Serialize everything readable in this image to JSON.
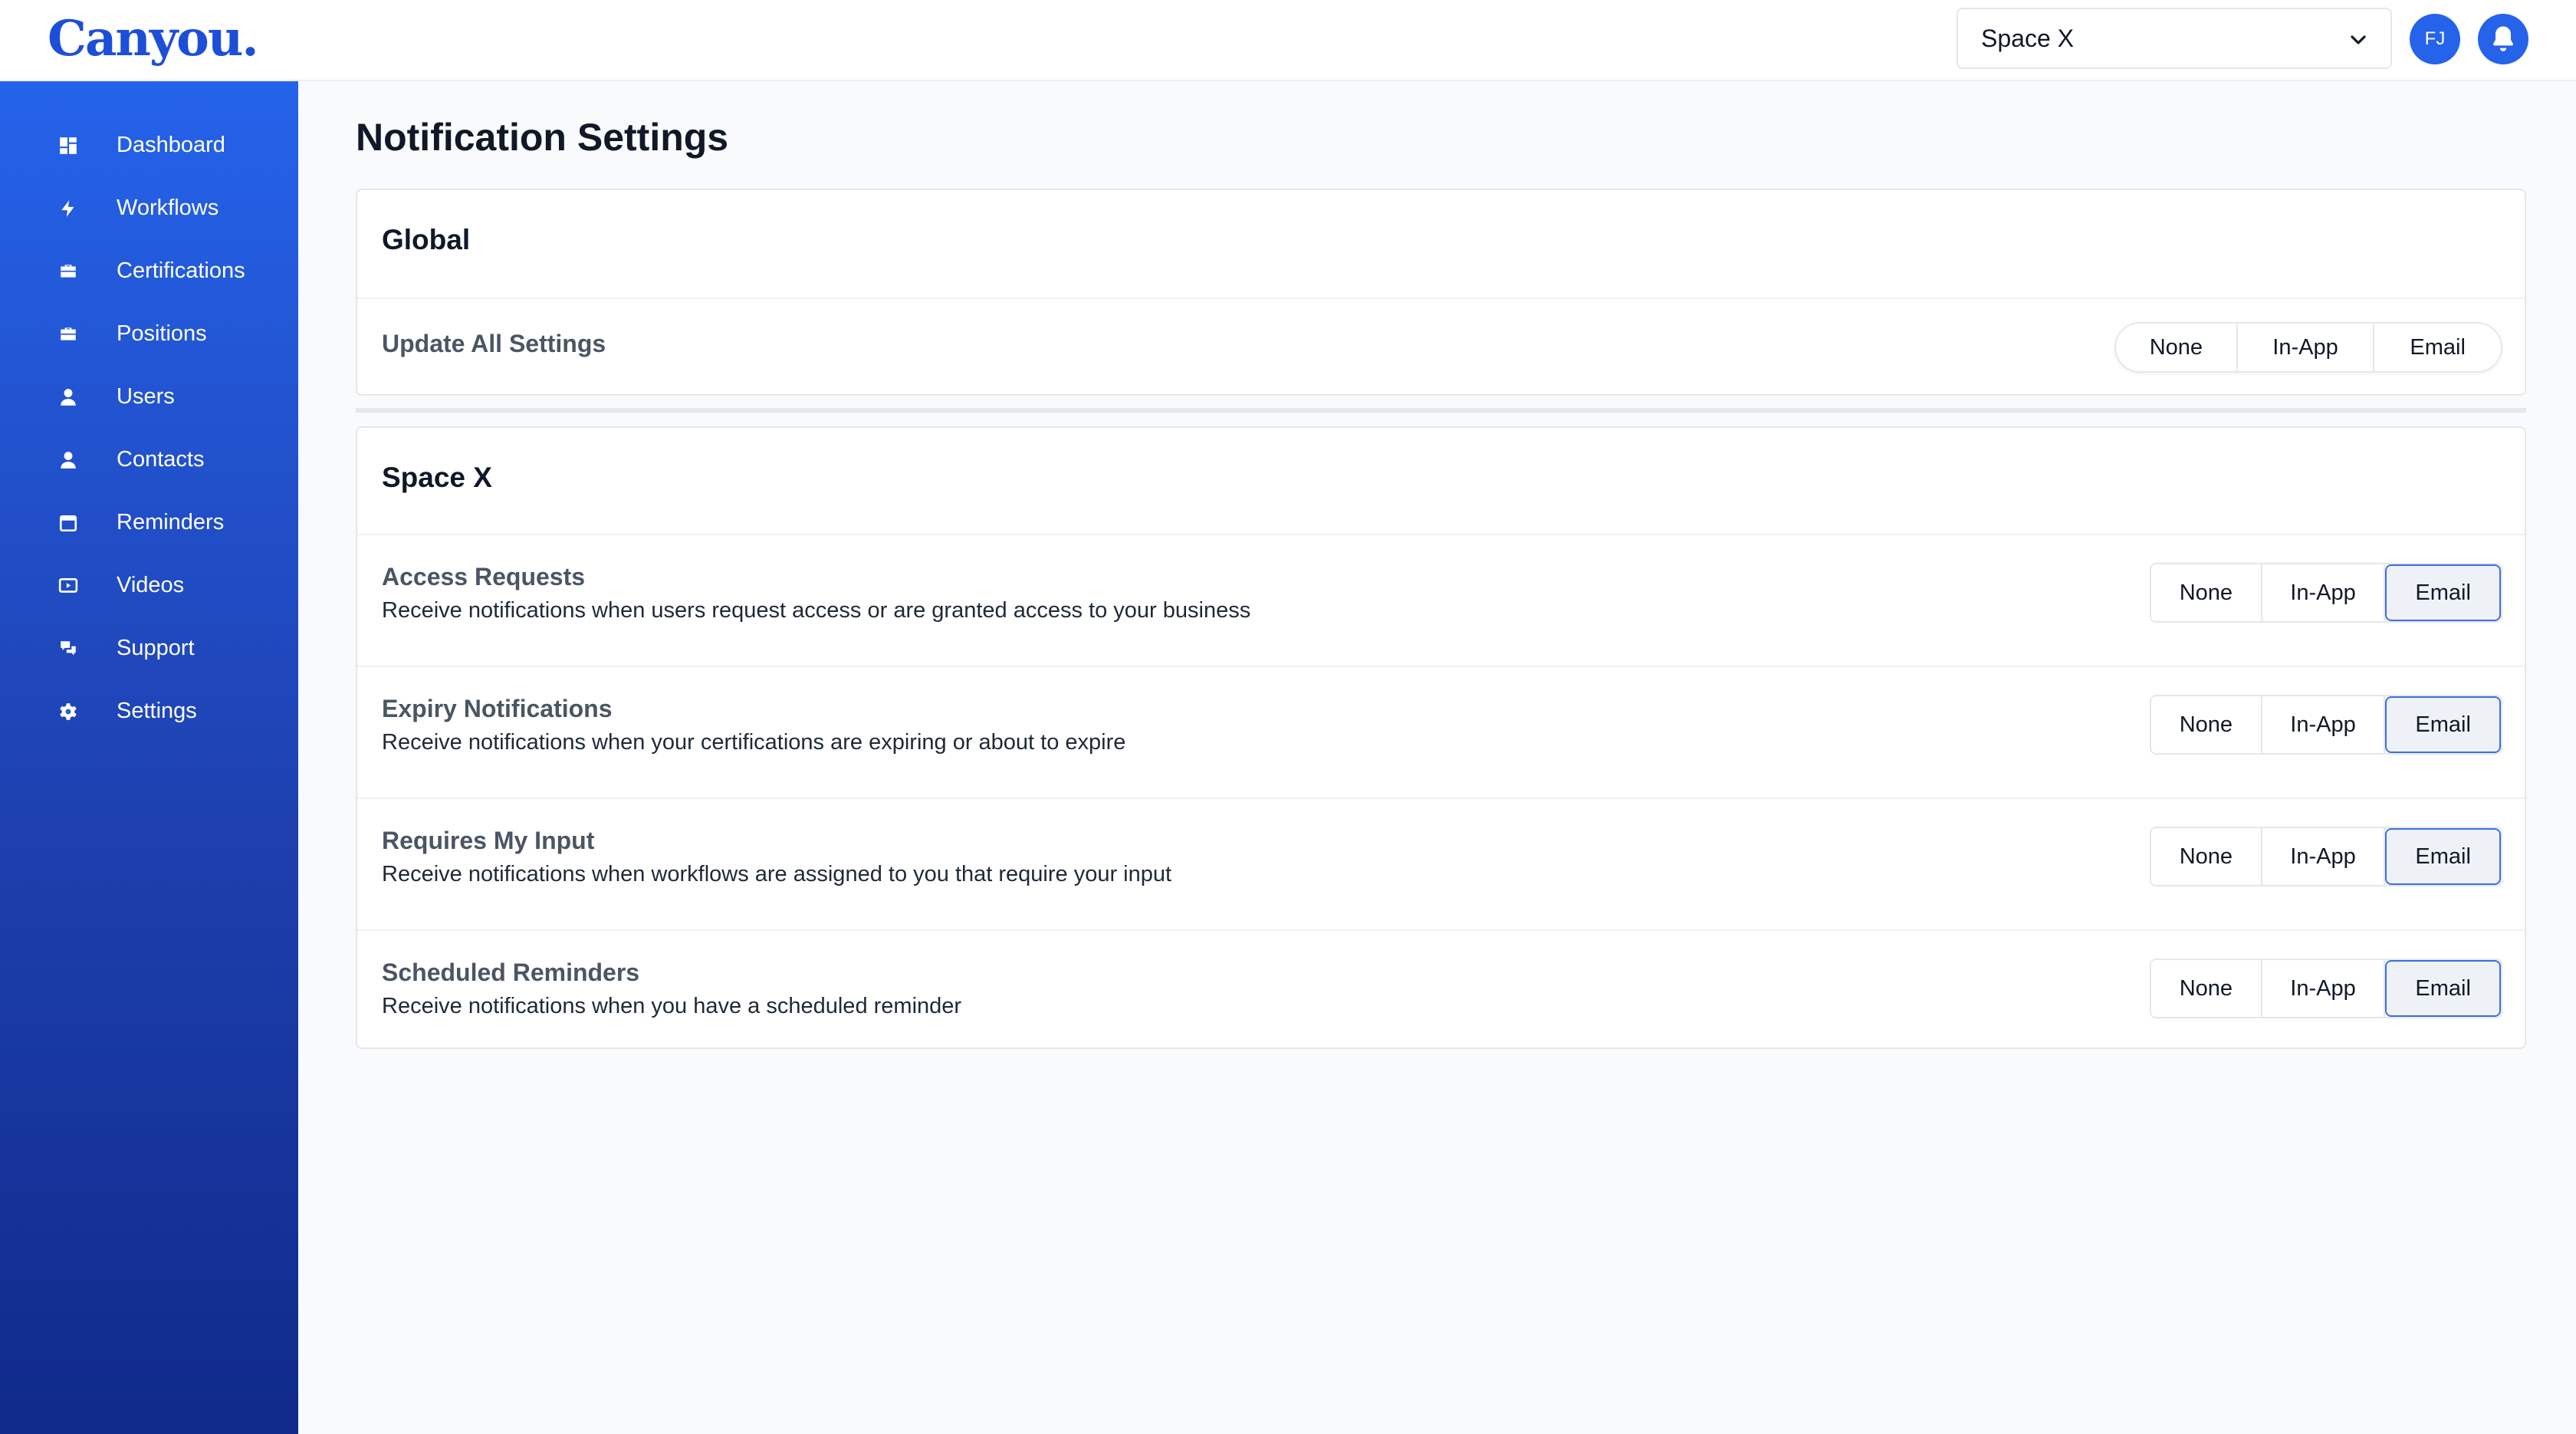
{
  "brand": {
    "logo_text": "Canyou."
  },
  "header": {
    "space_select": "Space X",
    "avatar_initials": "FJ"
  },
  "sidebar": {
    "items": [
      {
        "label": "Dashboard",
        "icon": "dashboard-icon"
      },
      {
        "label": "Workflows",
        "icon": "bolt-icon"
      },
      {
        "label": "Certifications",
        "icon": "briefcase-icon"
      },
      {
        "label": "Positions",
        "icon": "briefcase-icon"
      },
      {
        "label": "Users",
        "icon": "user-icon"
      },
      {
        "label": "Contacts",
        "icon": "user-icon"
      },
      {
        "label": "Reminders",
        "icon": "calendar-icon"
      },
      {
        "label": "Videos",
        "icon": "video-icon"
      },
      {
        "label": "Support",
        "icon": "support-icon"
      },
      {
        "label": "Settings",
        "icon": "gear-icon"
      }
    ]
  },
  "page": {
    "title": "Notification Settings"
  },
  "global": {
    "title": "Global",
    "update_all_label": "Update All Settings",
    "options": [
      "None",
      "In-App",
      "Email"
    ]
  },
  "space": {
    "title": "Space X",
    "options": [
      "None",
      "In-App",
      "Email"
    ],
    "rows": [
      {
        "title": "Access Requests",
        "desc": "Receive notifications when users request access or are granted access to your business",
        "selected": "Email"
      },
      {
        "title": "Expiry Notifications",
        "desc": "Receive notifications when your certifications are expiring or about to expire",
        "selected": "Email"
      },
      {
        "title": "Requires My Input",
        "desc": "Receive notifications when workflows are assigned to you that require your input",
        "selected": "Email"
      },
      {
        "title": "Scheduled Reminders",
        "desc": "Receive notifications when you have a scheduled reminder",
        "selected": "Email"
      }
    ]
  },
  "colors": {
    "brand": "#2563eb",
    "sidebar_top": "#2563eb",
    "sidebar_bottom": "#0f2a8a",
    "active_border": "#3b6fe0"
  }
}
